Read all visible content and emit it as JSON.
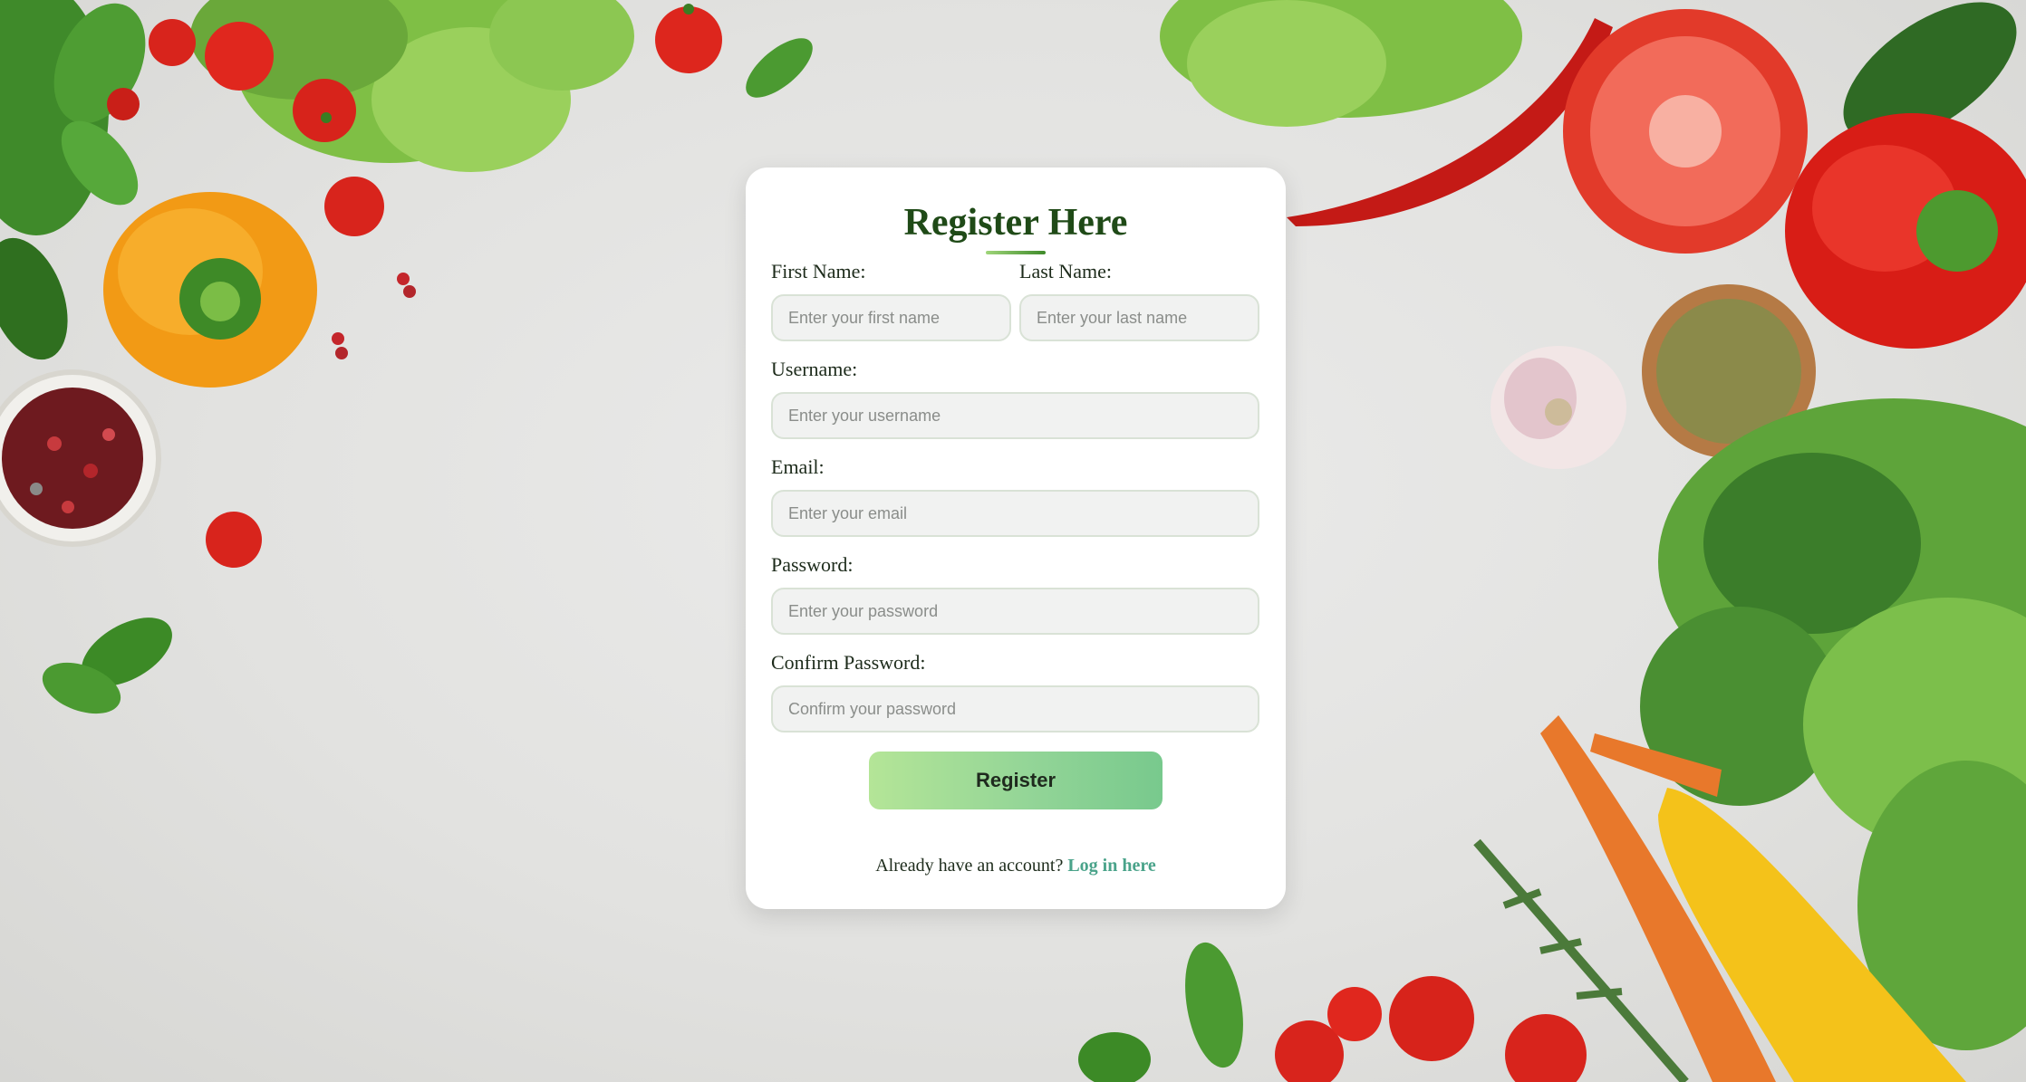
{
  "form": {
    "title": "Register Here",
    "first_name": {
      "label": "First Name:",
      "placeholder": "Enter your first name"
    },
    "last_name": {
      "label": "Last Name:",
      "placeholder": "Enter your last name"
    },
    "username": {
      "label": "Username:",
      "placeholder": "Enter your username"
    },
    "email": {
      "label": "Email:",
      "placeholder": "Enter your email"
    },
    "password": {
      "label": "Password:",
      "placeholder": "Enter your password"
    },
    "confirm_password": {
      "label": "Confirm Password:",
      "placeholder": "Confirm your password"
    },
    "submit_label": "Register",
    "footer_text": "Already have an account?",
    "login_link": "Log in here"
  },
  "colors": {
    "title": "#1f4a17",
    "link": "#4aa38a",
    "button_gradient_start": "#b4e597",
    "button_gradient_end": "#78c98d"
  },
  "background": {
    "icons": [
      "lettuce-icon",
      "tomato-icon",
      "bell-pepper-icon",
      "chili-pepper-icon",
      "garlic-icon",
      "broccoli-icon",
      "carrot-icon",
      "peppercorn-bowl-icon",
      "seed-bowl-icon",
      "parsley-icon",
      "rosemary-icon",
      "cucumber-icon",
      "yellow-pepper-icon"
    ]
  }
}
